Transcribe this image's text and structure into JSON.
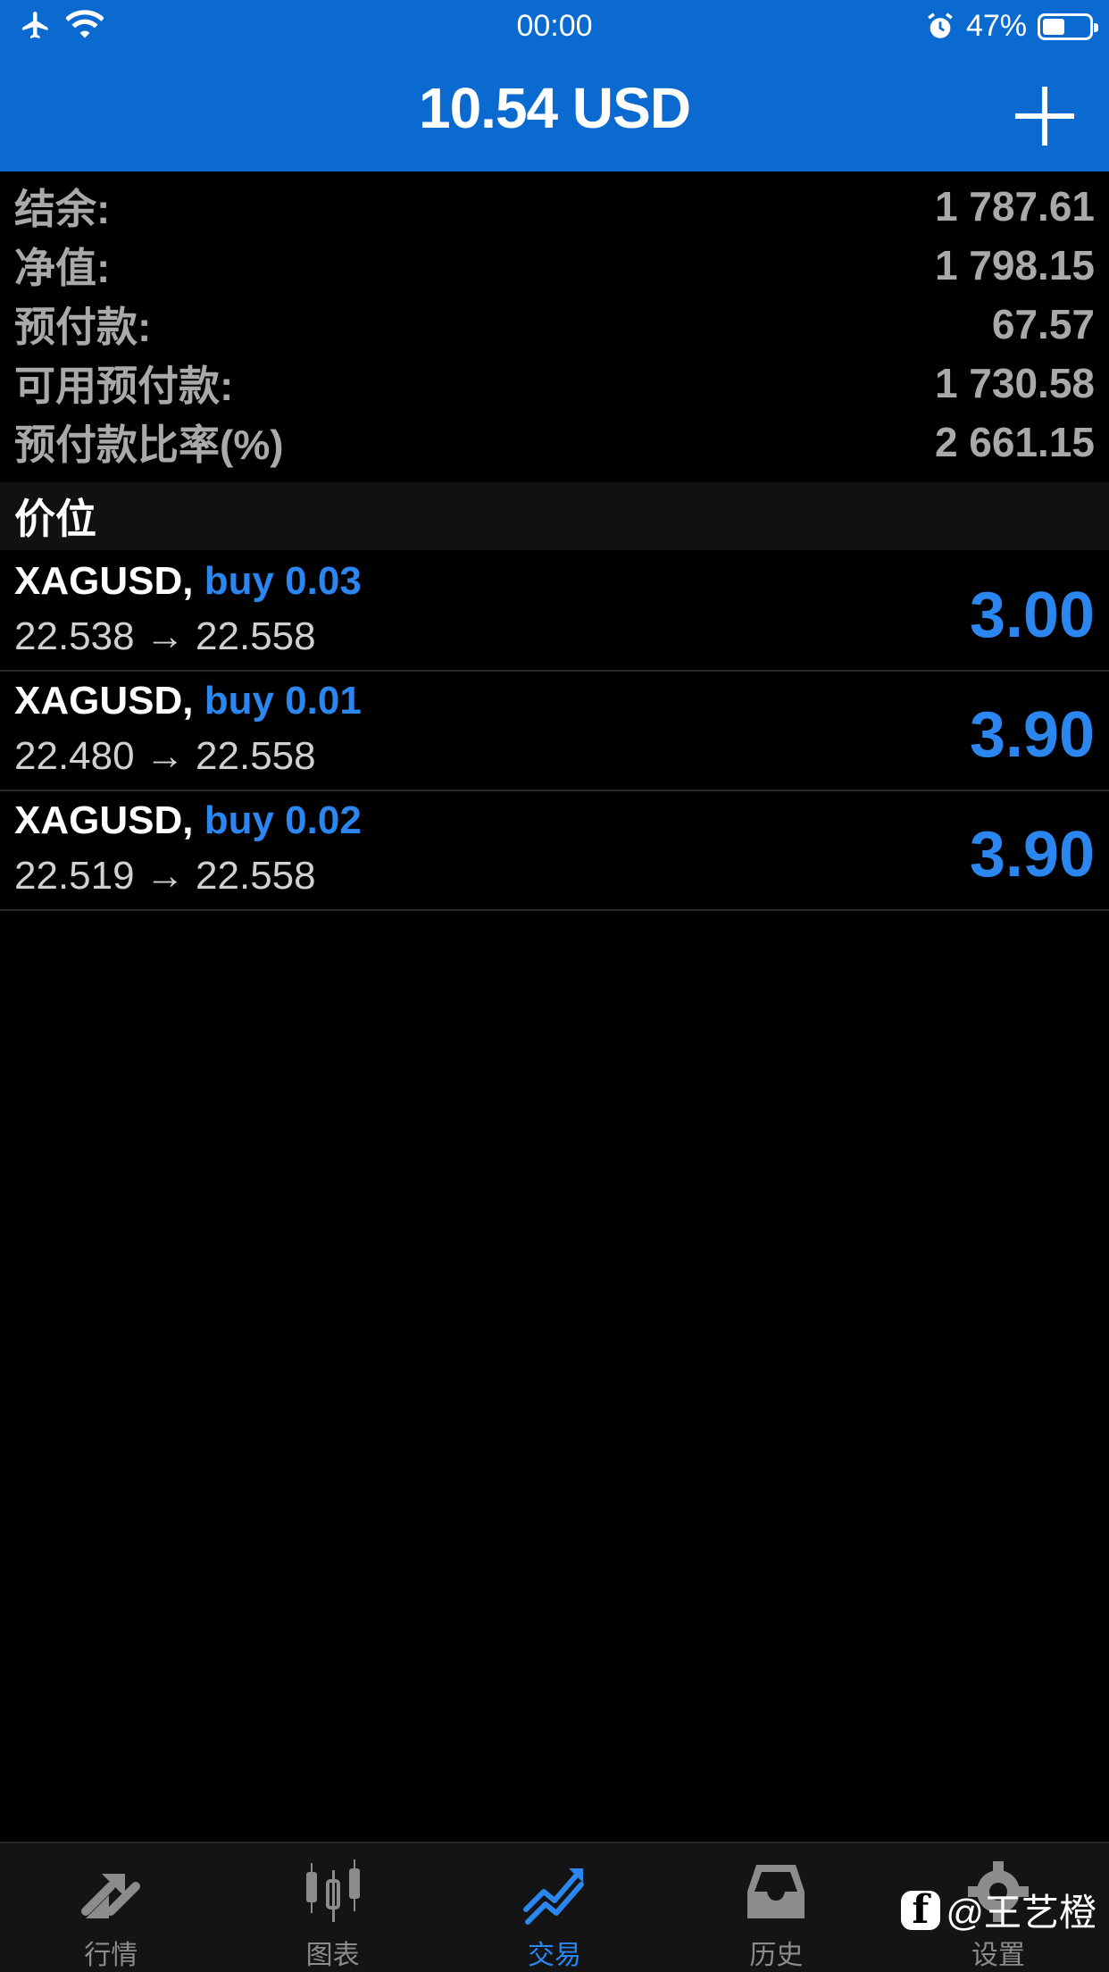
{
  "status_bar": {
    "time": "00:00",
    "battery_pct": "47%",
    "battery_level": 0.47,
    "icons": [
      "airplane-icon",
      "wifi-icon",
      "alarm-icon",
      "battery-icon"
    ]
  },
  "header": {
    "title": "10.54 USD",
    "add_icon": "plus-icon"
  },
  "summary": [
    {
      "label": "结余:",
      "value": "1 787.61"
    },
    {
      "label": "净值:",
      "value": "1 798.15"
    },
    {
      "label": "预付款:",
      "value": "67.57"
    },
    {
      "label": "可用预付款:",
      "value": "1 730.58"
    },
    {
      "label": "预付款比率(%)",
      "value": "2 661.15"
    }
  ],
  "section": {
    "title": "价位"
  },
  "positions": [
    {
      "symbol": "XAGUSD,",
      "order": "buy 0.03",
      "prices": "22.538 → 22.558",
      "profit": "3.00"
    },
    {
      "symbol": "XAGUSD,",
      "order": "buy 0.01",
      "prices": "22.480 → 22.558",
      "profit": "3.90"
    },
    {
      "symbol": "XAGUSD,",
      "order": "buy 0.02",
      "prices": "22.519 → 22.558",
      "profit": "3.90"
    }
  ],
  "tabs": [
    {
      "label": "行情",
      "icon": "quotes-icon",
      "active": false
    },
    {
      "label": "图表",
      "icon": "chart-icon",
      "active": false
    },
    {
      "label": "交易",
      "icon": "trade-icon",
      "active": true
    },
    {
      "label": "历史",
      "icon": "history-icon",
      "active": false
    },
    {
      "label": "设置",
      "icon": "settings-icon",
      "active": false
    }
  ],
  "watermark": {
    "text": "@王艺橙"
  },
  "colors": {
    "header_bg": "#0a6ad0",
    "accent": "#2b86f0",
    "muted": "#a9a9a9",
    "background": "#000000"
  }
}
